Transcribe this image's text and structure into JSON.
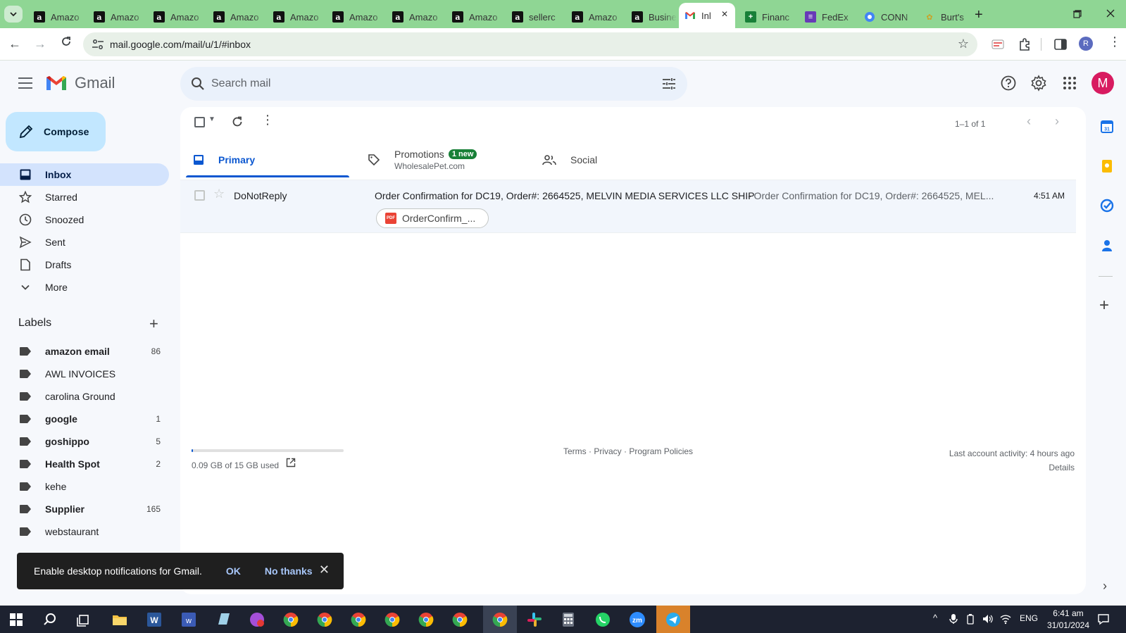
{
  "browser": {
    "tabs": [
      {
        "title": "Amazo",
        "favicon": "amazon-icon"
      },
      {
        "title": "Amazo",
        "favicon": "amazon-icon"
      },
      {
        "title": "Amazo",
        "favicon": "amazon-icon"
      },
      {
        "title": "Amazo",
        "favicon": "amazon-icon"
      },
      {
        "title": "Amazo",
        "favicon": "amazon-icon"
      },
      {
        "title": "Amazo",
        "favicon": "amazon-icon"
      },
      {
        "title": "Amazo",
        "favicon": "amazon-icon"
      },
      {
        "title": "Amazo",
        "favicon": "amazon-icon"
      },
      {
        "title": "sellerc",
        "favicon": "amazon-icon"
      },
      {
        "title": "Amazo",
        "favicon": "amazon-icon"
      },
      {
        "title": "Busine",
        "favicon": "amazon-icon"
      },
      {
        "title": "Inl",
        "favicon": "gmail-icon",
        "active": true
      },
      {
        "title": "Financ",
        "favicon": "sheets-icon"
      },
      {
        "title": "FedEx",
        "favicon": "forms-icon"
      },
      {
        "title": "CONN",
        "favicon": "chrome-icon"
      },
      {
        "title": "Burt's",
        "favicon": "bee-icon"
      }
    ],
    "url": "mail.google.com/mail/u/1/#inbox",
    "profile_initial": "R"
  },
  "gmail": {
    "app_name": "Gmail",
    "search_placeholder": "Search mail",
    "avatar_initial": "M",
    "compose_label": "Compose",
    "nav": [
      {
        "label": "Inbox",
        "icon": "inbox-icon",
        "active": true
      },
      {
        "label": "Starred",
        "icon": "star-icon"
      },
      {
        "label": "Snoozed",
        "icon": "clock-icon"
      },
      {
        "label": "Sent",
        "icon": "send-icon"
      },
      {
        "label": "Drafts",
        "icon": "draft-icon"
      },
      {
        "label": "More",
        "icon": "chevron-down-icon"
      }
    ],
    "labels_heading": "Labels",
    "labels": [
      {
        "name": "amazon email",
        "count": "86",
        "bold": true
      },
      {
        "name": "AWL INVOICES",
        "count": "",
        "bold": false
      },
      {
        "name": "carolina Ground",
        "count": "",
        "bold": false
      },
      {
        "name": "google",
        "count": "1",
        "bold": true
      },
      {
        "name": "goshippo",
        "count": "5",
        "bold": true
      },
      {
        "name": "Health Spot",
        "count": "2",
        "bold": true
      },
      {
        "name": "kehe",
        "count": "",
        "bold": false
      },
      {
        "name": "Supplier",
        "count": "165",
        "bold": true
      },
      {
        "name": "webstaurant",
        "count": "",
        "bold": false
      }
    ],
    "page_count": "1–1 of 1",
    "tabs": {
      "primary": "Primary",
      "promotions": "Promotions",
      "promotions_badge": "1 new",
      "promotions_sub": "WholesalePet.com",
      "social": "Social"
    },
    "emails": [
      {
        "sender": "DoNotReply",
        "subject": "Order Confirmation for DC19, Order#: 2664525, MELVIN MEDIA SERVICES LLC SHIP",
        "snippet": " - Order Confirmation for DC19, Order#: 2664525, MEL...",
        "time": "4:51 AM",
        "attachment": "OrderConfirm_..."
      }
    ],
    "storage": {
      "text": "0.09 GB of 15 GB used",
      "used_fraction": 0.006
    },
    "footer": {
      "terms": "Terms",
      "privacy": "Privacy",
      "policies": "Program Policies"
    },
    "activity": {
      "text": "Last account activity: 4 hours ago",
      "details": "Details"
    },
    "toast": {
      "message": "Enable desktop notifications for Gmail.",
      "ok": "OK",
      "no_thanks": "No thanks"
    }
  },
  "taskbar": {
    "language": "ENG",
    "time": "6:41 am",
    "date": "31/01/2024"
  },
  "colors": {
    "tabstrip": "#8fd694",
    "compose": "#c2e7ff",
    "inbox_active": "#d3e3fd",
    "accent_blue": "#0b57d0",
    "badge_green": "#188038",
    "avatar": "#d81b60"
  }
}
